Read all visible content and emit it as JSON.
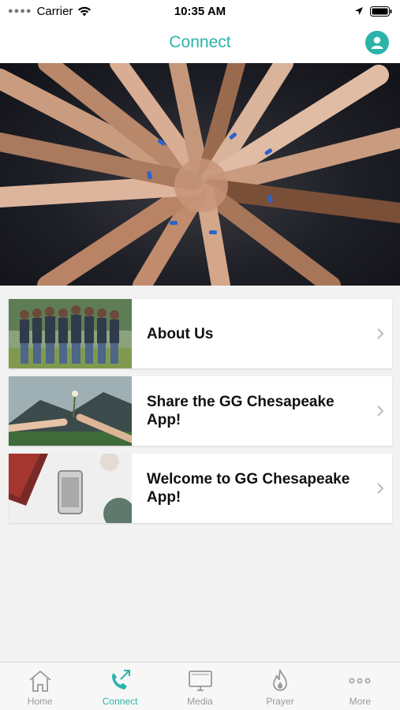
{
  "status_bar": {
    "carrier": "Carrier",
    "time": "10:35 AM"
  },
  "header": {
    "title": "Connect"
  },
  "cards": [
    {
      "label": "About Us"
    },
    {
      "label": "Share the GG Chesapeake App!"
    },
    {
      "label": "Welcome to GG Chesapeake App!"
    }
  ],
  "tabs": [
    {
      "label": "Home",
      "icon": "home-icon"
    },
    {
      "label": "Connect",
      "icon": "connect-icon",
      "active": true
    },
    {
      "label": "Media",
      "icon": "media-icon"
    },
    {
      "label": "Prayer",
      "icon": "prayer-icon"
    },
    {
      "label": "More",
      "icon": "more-icon"
    }
  ],
  "colors": {
    "accent": "#2bb3aa",
    "inactive": "#999999"
  }
}
